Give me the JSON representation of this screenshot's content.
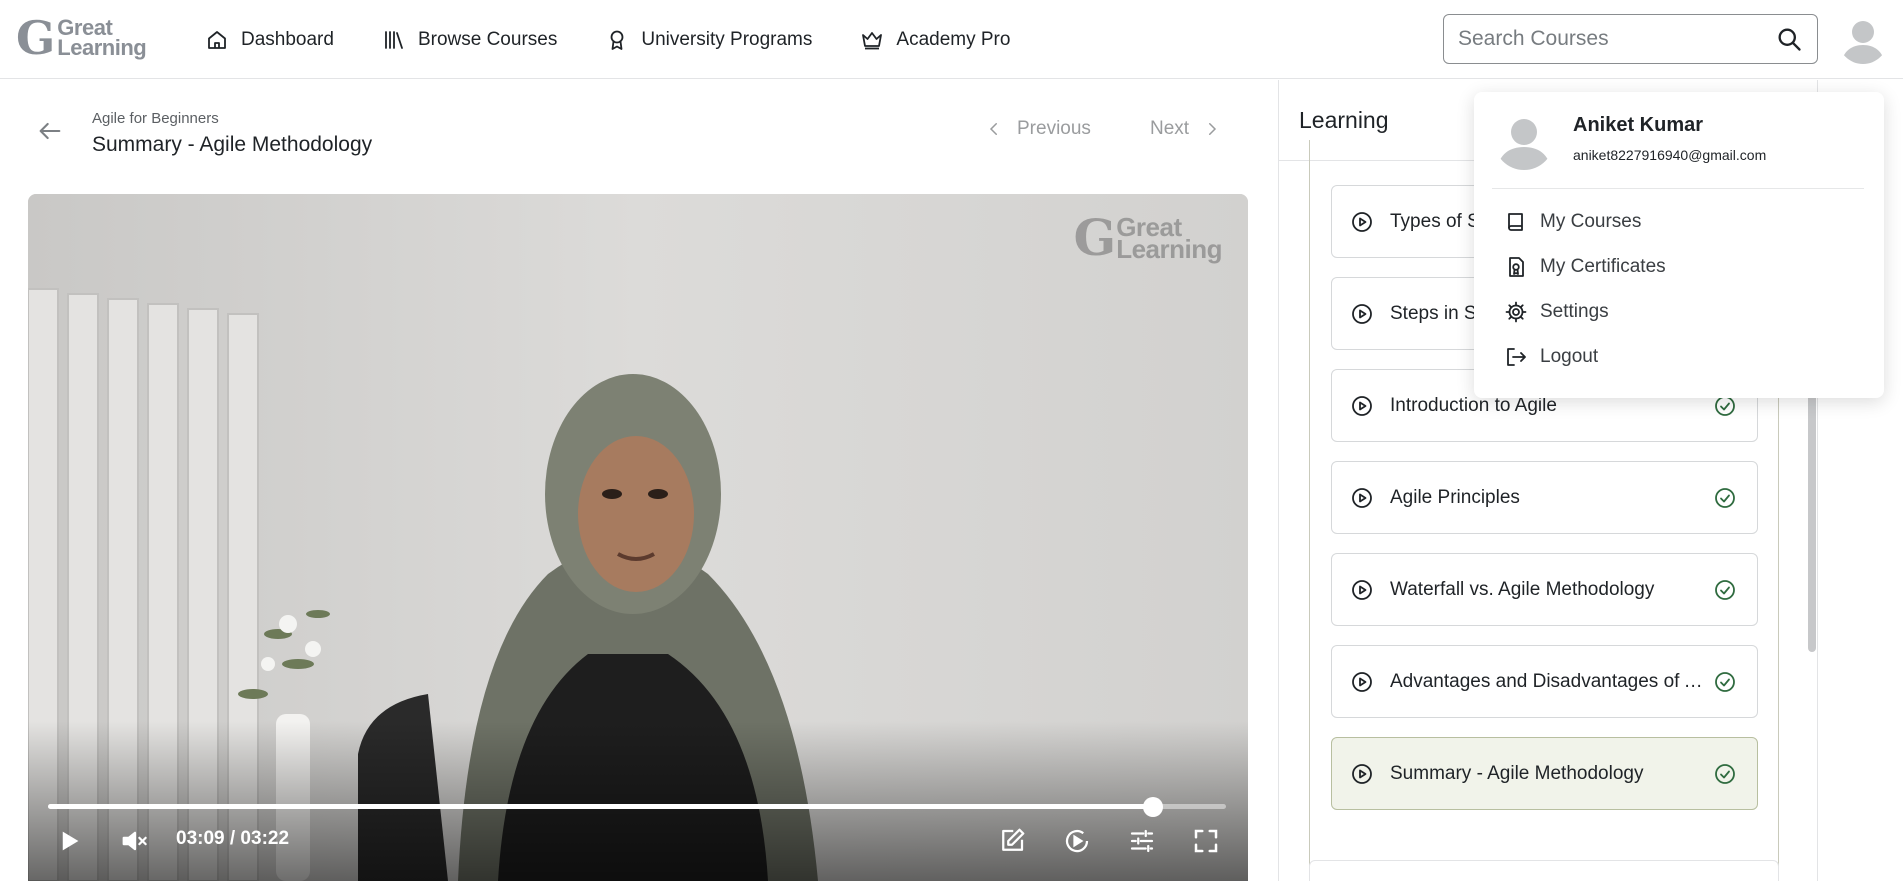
{
  "navbar": {
    "logo": {
      "glyph": "G",
      "line1": "Great",
      "line2": "Learning"
    },
    "items": [
      {
        "label": "Dashboard",
        "icon": "home-icon"
      },
      {
        "label": "Browse Courses",
        "icon": "library-icon"
      },
      {
        "label": "University Programs",
        "icon": "award-icon"
      },
      {
        "label": "Academy Pro",
        "icon": "crown-icon"
      }
    ],
    "search": {
      "placeholder": "Search Courses",
      "value": ""
    }
  },
  "lecture": {
    "course": "Agile for Beginners",
    "title": "Summary - Agile Methodology",
    "previous_label": "Previous",
    "next_label": "Next"
  },
  "video": {
    "watermark": {
      "glyph": "G",
      "line1": "Great",
      "line2": "Learning"
    },
    "time": "03:09 / 03:22",
    "progress": 0.938,
    "colors": {
      "progress": "#ffffff",
      "track": "rgba(255,255,255,0.45)"
    }
  },
  "panel": {
    "title": "Learning",
    "lessons": [
      {
        "label": "Types of SDLC Models",
        "completed": true,
        "active": false
      },
      {
        "label": "Steps in SDLC",
        "completed": true,
        "active": false
      },
      {
        "label": "Introduction to Agile",
        "completed": true,
        "active": false
      },
      {
        "label": "Agile Principles",
        "completed": true,
        "active": false
      },
      {
        "label": "Waterfall vs. Agile Methodology",
        "completed": true,
        "active": false
      },
      {
        "label": "Advantages and Disadvantages of A...",
        "completed": true,
        "active": false
      },
      {
        "label": "Summary - Agile Methodology",
        "completed": true,
        "active": true
      }
    ],
    "colors": {
      "check": "#2f6b3f",
      "active_bg": "#f1f3ea"
    }
  },
  "profile_menu": {
    "name": "Aniket Kumar",
    "email": "aniket8227916940@gmail.com",
    "items": [
      {
        "label": "My Courses",
        "icon": "book-icon"
      },
      {
        "label": "My Certificates",
        "icon": "certificate-icon"
      },
      {
        "label": "Settings",
        "icon": "gear-icon"
      },
      {
        "label": "Logout",
        "icon": "logout-icon"
      }
    ]
  }
}
